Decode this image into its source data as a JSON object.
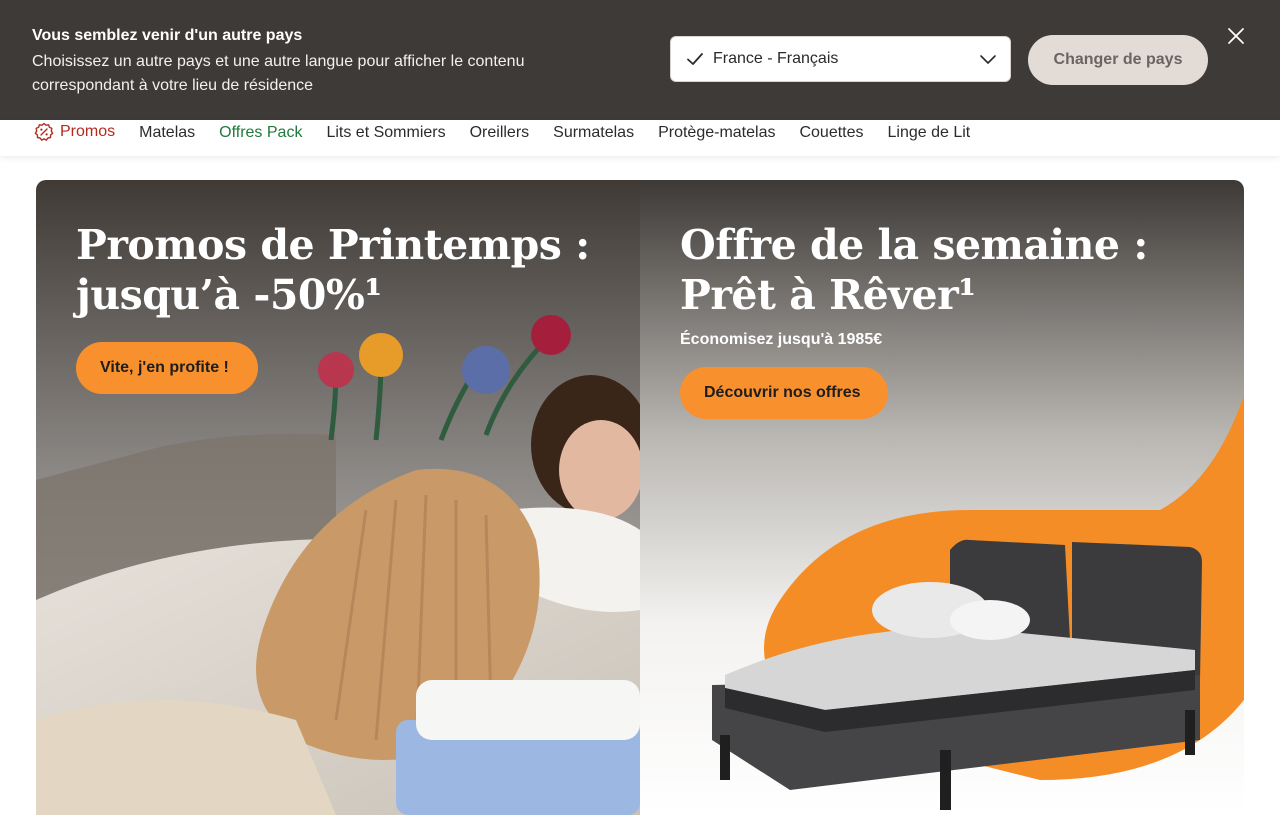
{
  "country_banner": {
    "title": "Vous semblez venir d'un autre pays",
    "description": "Choisissez un autre pays et une autre langue pour afficher le contenu correspondant à votre lieu de résidence",
    "selected_country": "France - Français",
    "change_button": "Changer de pays",
    "bg_color": "#3e3a37",
    "icons": {
      "selected": "check-icon",
      "dropdown": "chevron-down-icon",
      "close": "close-icon"
    }
  },
  "category_nav": {
    "items": [
      "Promos",
      "Matelas",
      "Offres Pack",
      "Lits et Sommiers",
      "Oreillers",
      "Surmatelas",
      "Protège-matelas",
      "Couettes",
      "Linge de Lit"
    ],
    "promo_icon": "discount-badge-icon",
    "promo_color": "#b42a1e",
    "pack_color": "#1f7a3c"
  },
  "hero_left": {
    "title": "Promos de Printemps : jusqu’à -50%¹",
    "cta": "Vite, j'en profite !"
  },
  "hero_right": {
    "title": "Offre de la semaine : Prêt à Rêver¹",
    "subtitle": "Économisez jusqu'à 1985€",
    "cta": "Découvrir nos offres"
  },
  "colors": {
    "cta": "#f8912d",
    "accent_orange": "#f58d27"
  }
}
